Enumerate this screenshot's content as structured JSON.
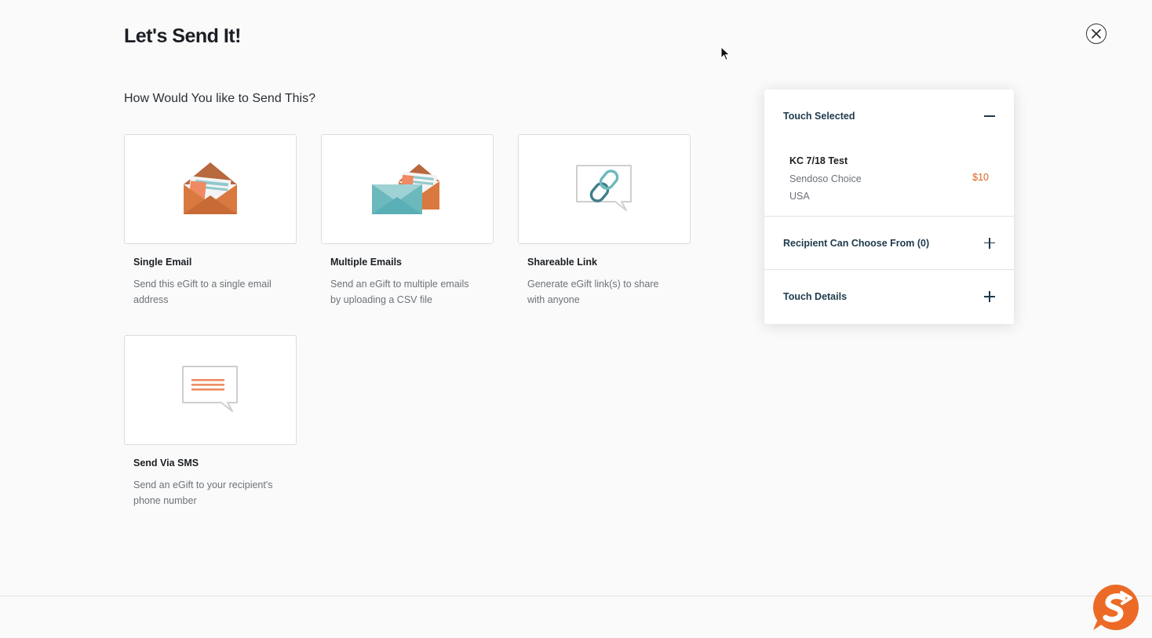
{
  "page": {
    "title": "Let's Send It!",
    "section_heading": "How Would You like to Send This?"
  },
  "options": [
    {
      "title": "Single Email",
      "description": "Send this eGift to a single email address",
      "icon": "single-email-icon"
    },
    {
      "title": "Multiple Emails",
      "description": "Send an eGift to multiple emails by uploading a CSV file",
      "icon": "multiple-emails-icon"
    },
    {
      "title": "Shareable Link",
      "description": "Generate eGift link(s) to share with anyone",
      "icon": "shareable-link-icon"
    },
    {
      "title": "Send Via SMS",
      "description": "Send an eGift to your recipient's phone number",
      "icon": "sms-icon"
    }
  ],
  "panel": {
    "touch_selected_label": "Touch Selected",
    "touch": {
      "name": "KC 7/18 Test",
      "brand": "Sendoso Choice",
      "country": "USA",
      "price": "$10"
    },
    "recipient_label": "Recipient Can Choose From (0)",
    "details_label": "Touch Details"
  },
  "colors": {
    "accent": "#e0621f",
    "panel_text": "#1e3a4c",
    "teal": "#5aaeb5"
  }
}
